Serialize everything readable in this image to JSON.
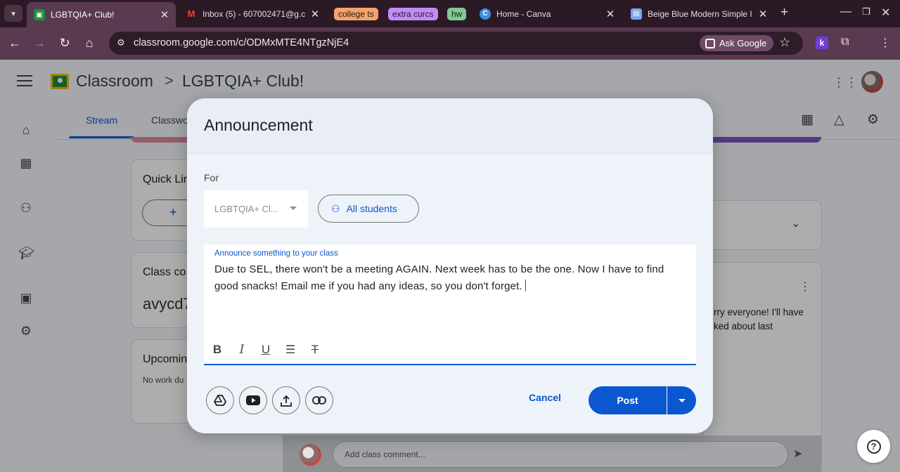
{
  "browser": {
    "tabs": [
      {
        "title": "LGBTQIA+ Club!",
        "favicon": "classroom-icon"
      },
      {
        "title": "Inbox (5) - 607002471@g.c",
        "favicon": "gmail-icon"
      },
      {
        "title": "Home - Canva",
        "favicon": "canva-icon"
      },
      {
        "title": "Beige Blue Modern Simple I",
        "favicon": "docs-icon"
      }
    ],
    "tab_groups": [
      {
        "label": "college ts",
        "color": "#f7a26b"
      },
      {
        "label": "extra curcs",
        "color": "#c58af9"
      },
      {
        "label": "hw",
        "color": "#81c995"
      }
    ],
    "url": "classroom.google.com/c/ODMxMTE4NTgzNjE4",
    "ask_google": "Ask Google",
    "extension_k": "k"
  },
  "classroom": {
    "app_name": "Classroom",
    "breadcrumb_sep": ">",
    "class_name": "LGBTQIA+ Club!",
    "tabs": {
      "stream": "Stream",
      "classwork": "Classwo"
    },
    "cards": {
      "quick_links": "Quick Lin",
      "class_code_label": "Class co",
      "class_code_value": "avycd7",
      "upcoming": "Upcomin",
      "upcoming_text": "No work du"
    },
    "post_snippet_1": "rry everyone! I'll have",
    "post_snippet_2": "ked about last",
    "comment_placeholder": "Add class comment..."
  },
  "modal": {
    "title": "Announcement",
    "for_label": "For",
    "class_select_value": "LGBTQIA+ Cl...",
    "audience_button": "All students",
    "editor_label": "Announce something to your class",
    "editor_text": "Due to SEL, there won't be a meeting AGAIN. Next week has to be the one. Now I have to find good snacks! Email me if you had any ideas, so you don't forget.",
    "cancel": "Cancel",
    "post": "Post"
  },
  "colors": {
    "accent": "#0b57d0",
    "chrome": "#5a3a51"
  }
}
